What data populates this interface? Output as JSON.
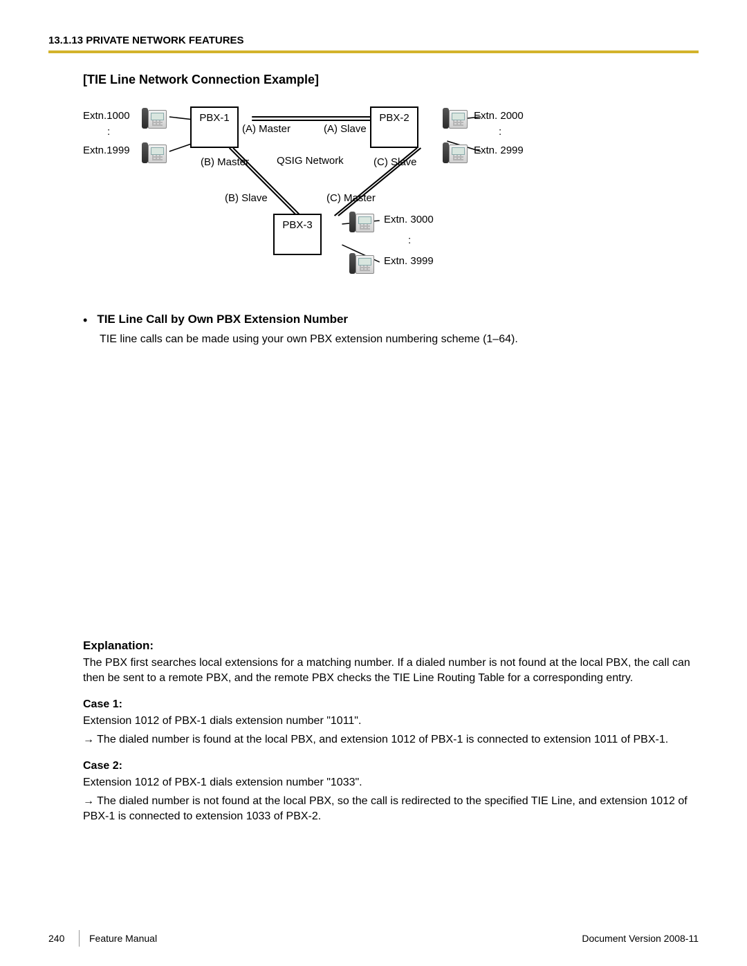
{
  "header": {
    "section": "13.1.13 PRIVATE NETWORK FEATURES"
  },
  "title": "[TIE Line Network Connection Example]",
  "diagram": {
    "pbx1": "PBX-1",
    "pbx2": "PBX-2",
    "pbx3": "PBX-3",
    "ext1000": "Extn.1000",
    "ext1999": "Extn.1999",
    "ext2000": "Extn. 2000",
    "ext2999": "Extn. 2999",
    "ext3000": "Extn. 3000",
    "ext3999": "Extn. 3999",
    "a_master": "(A) Master",
    "a_slave": "(A) Slave",
    "b_master": "(B) Master",
    "b_slave": "(B) Slave",
    "c_master": "(C) Master",
    "c_slave": "(C) Slave",
    "qsig": "QSIG Network",
    "colon": ":"
  },
  "bullet": {
    "dot": "•",
    "heading": "TIE Line Call by Own PBX Extension Number",
    "text": "TIE line calls can be made using your own PBX extension numbering scheme (1–64)."
  },
  "explanation": {
    "heading": "Explanation:",
    "text": "The PBX first searches local extensions for a matching number. If a dialed number is not found at the local PBX, the call can then be sent to a remote PBX, and the remote PBX checks the TIE Line Routing Table for a corresponding entry."
  },
  "case1": {
    "heading": "Case 1:",
    "l1": "Extension 1012 of PBX-1 dials extension number \"1011\".",
    "l2": "→ The dialed number is found at the local PBX, and extension 1012 of PBX-1 is connected to extension 1011 of PBX-1."
  },
  "case2": {
    "heading": "Case 2:",
    "l1": "Extension 1012 of PBX-1 dials extension number \"1033\".",
    "l2": "→ The dialed number is not found at the local PBX, so the call is redirected to the specified TIE Line, and extension 1012 of PBX-1 is connected to extension 1033 of PBX-2."
  },
  "footer": {
    "page": "240",
    "manual": "Feature Manual",
    "docver": "Document Version  2008-11"
  }
}
